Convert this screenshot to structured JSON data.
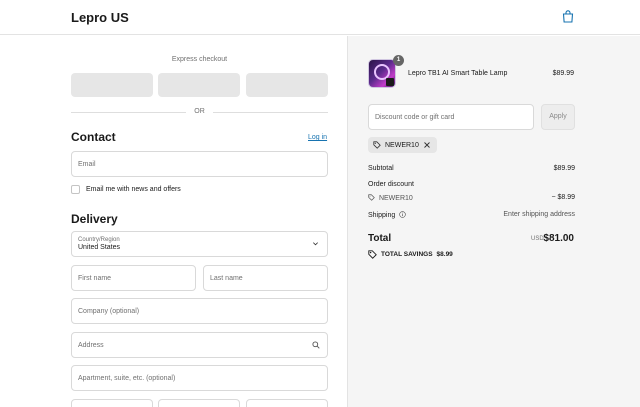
{
  "header": {
    "brand": "Lepro US"
  },
  "express": {
    "label": "Express checkout",
    "divider": "OR"
  },
  "contact": {
    "title": "Contact",
    "login_link": "Log in",
    "email_placeholder": "Email",
    "newsletter_label": "Email me with news and offers"
  },
  "delivery": {
    "title": "Delivery",
    "country_label": "Country/Region",
    "country_value": "United States",
    "first_name_placeholder": "First name",
    "last_name_placeholder": "Last name",
    "company_placeholder": "Company (optional)",
    "address_placeholder": "Address",
    "apartment_placeholder": "Apartment, suite, etc. (optional)"
  },
  "order": {
    "product_name": "Lepro TB1 AI Smart Table Lamp",
    "product_price": "$89.99",
    "quantity": "1",
    "discount_placeholder": "Discount code or gift card",
    "apply_label": "Apply",
    "applied_code": "NEWER10",
    "subtotal_label": "Subtotal",
    "subtotal_value": "$89.99",
    "order_discount_label": "Order discount",
    "discount_code": "NEWER10",
    "discount_value": "− $8.99",
    "shipping_label": "Shipping",
    "shipping_value": "Enter shipping address",
    "total_label": "Total",
    "total_currency": "USD",
    "total_value": "$81.00",
    "savings_label": "TOTAL SAVINGS",
    "savings_value": "$8.99"
  },
  "colors": {
    "link": "#1773b0",
    "panel_bg": "#f5f5f5"
  },
  "icons": [
    "shopping-bag-icon",
    "chevron-down-icon",
    "search-icon",
    "tag-icon",
    "close-icon",
    "info-icon"
  ]
}
